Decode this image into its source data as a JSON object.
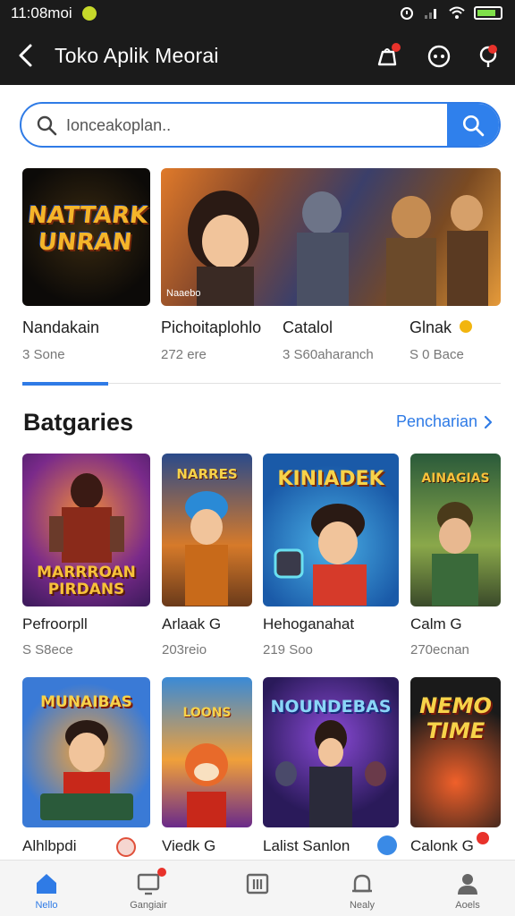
{
  "status_bar": {
    "time": "11:08moi"
  },
  "app_bar": {
    "title": "Toko Aplik Meorai"
  },
  "search": {
    "placeholder": "Ionceakoplan.."
  },
  "featured": [
    {
      "name": "Nandakain",
      "sub": "3 Sone",
      "art_text": "NATTARK\nUNRAN"
    },
    {
      "name": "Pichoitaplohlo",
      "sub": "272 ere",
      "art_text": ""
    },
    {
      "name": "Catalol",
      "sub": "3 S60aharanch",
      "art_text": ""
    },
    {
      "name": "Glnak",
      "sub": "S 0 Bace",
      "art_text": ""
    }
  ],
  "featured_caption": "Naaebo",
  "section": {
    "title": "Batgaries",
    "more_label": "Pencharian"
  },
  "grid": [
    {
      "name": "Pefroorpll",
      "sub": "S S8ece",
      "art_text": "MARRROAN\nPIRDANS"
    },
    {
      "name": "Arlaak G",
      "sub": "203reio",
      "art_text": "NARRES"
    },
    {
      "name": "Hehoganahat",
      "sub": "219 Soo",
      "art_text": "KINIADEK"
    },
    {
      "name": "Calm G",
      "sub": "270ecnan",
      "art_text": "AINAGIAS"
    },
    {
      "name": "Alhlbpdi",
      "sub": "",
      "art_text": "MUNAIBAS"
    },
    {
      "name": "Viedk G",
      "sub": "",
      "art_text": "LOONS"
    },
    {
      "name": "Lalist Sanlon",
      "sub": "",
      "art_text": "NOUNDEBAS"
    },
    {
      "name": "Calonk G",
      "sub": "",
      "art_text": "NEMO\nTIME"
    }
  ],
  "bottom_nav": [
    {
      "label": "Nello",
      "icon": "home-icon",
      "active": true
    },
    {
      "label": "Gangiair",
      "icon": "screen-icon",
      "active": false
    },
    {
      "label": "",
      "icon": "apps-icon",
      "active": false
    },
    {
      "label": "Nealy",
      "icon": "bell-icon",
      "active": false
    },
    {
      "label": "Aoels",
      "icon": "profile-icon",
      "active": false
    }
  ],
  "colors": {
    "accent": "#2f7be6",
    "topbar": "#1b1b1b",
    "badge": "#e8322b"
  }
}
